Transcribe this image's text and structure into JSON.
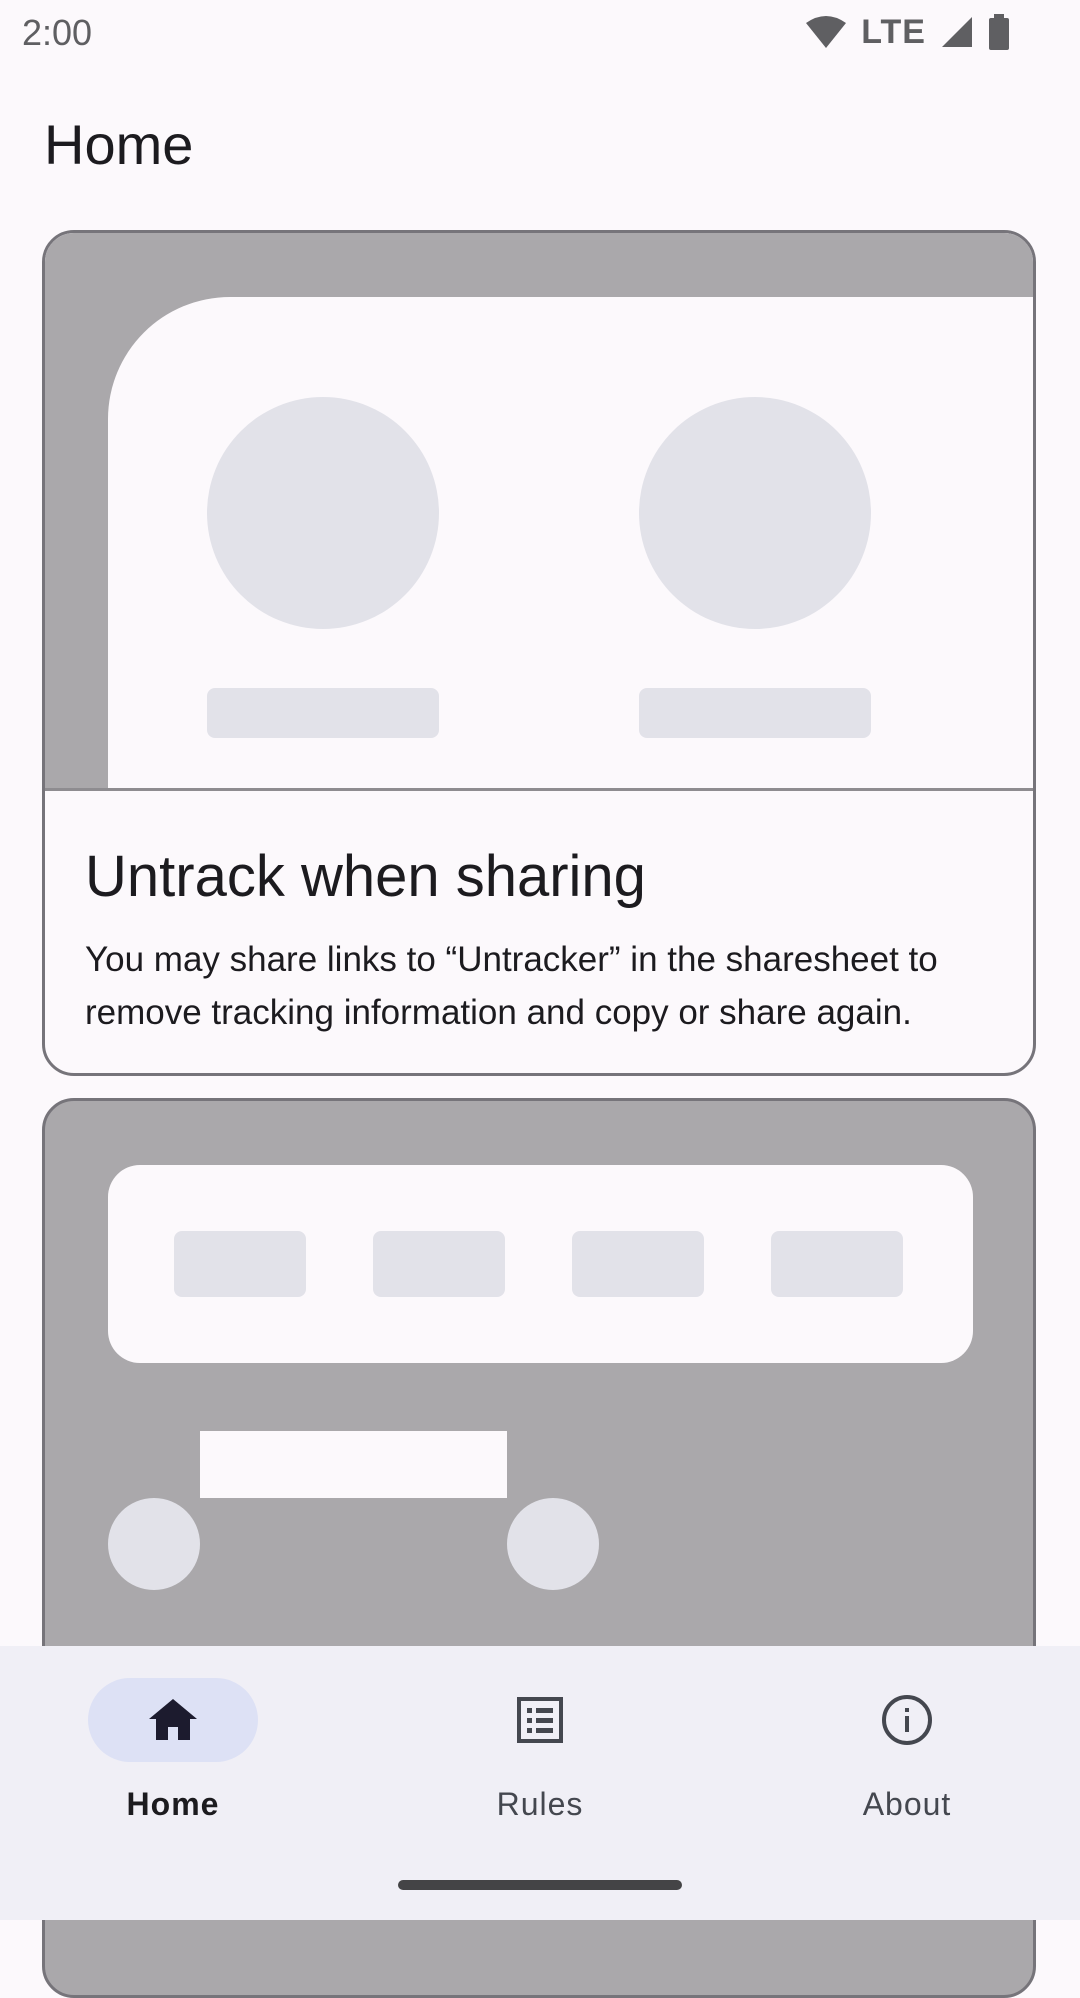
{
  "status_bar": {
    "time": "2:00",
    "network": "LTE",
    "icons": [
      "wifi-icon",
      "cell-signal-icon",
      "battery-icon"
    ]
  },
  "page": {
    "title": "Home"
  },
  "cards": [
    {
      "title": "Untrack when sharing",
      "description": "You may share links to “Untracker” in the sharesheet to remove tracking information and copy or share again."
    }
  ],
  "bottom_nav": {
    "items": [
      {
        "label": "Home",
        "icon": "home-icon",
        "active": true
      },
      {
        "label": "Rules",
        "icon": "list-icon",
        "active": false
      },
      {
        "label": "About",
        "icon": "info-icon",
        "active": false
      }
    ]
  },
  "colors": {
    "background": "#fcf9fc",
    "illustration_gray": "#aaa8ab",
    "placeholder": "#e2e2e9",
    "nav_background": "#f0eff6",
    "active_indicator": "#dde1f5"
  }
}
